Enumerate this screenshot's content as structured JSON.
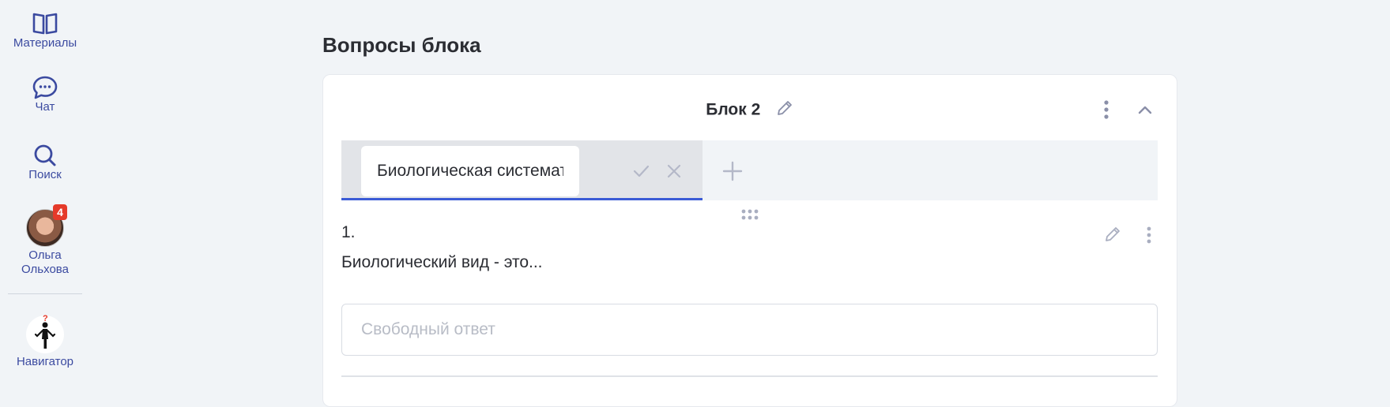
{
  "sidebar": {
    "items": [
      {
        "label": "Материалы",
        "icon": "book-icon"
      },
      {
        "label": "Чат",
        "icon": "chat-icon"
      },
      {
        "label": "Поиск",
        "icon": "search-icon"
      },
      {
        "label": "Ольга Ольхова",
        "icon": "avatar",
        "badge": "4"
      },
      {
        "label": "Навигатор",
        "icon": "navigator-icon"
      }
    ]
  },
  "main": {
    "title": "Вопросы блока",
    "block": {
      "title": "Блок 2",
      "tab": {
        "value": "Биологическая систематика"
      },
      "question": {
        "number": "1.",
        "text": "Биологический вид - это...",
        "answer_placeholder": "Свободный ответ"
      }
    }
  },
  "colors": {
    "accent": "#3b5bd6",
    "nav_text": "#3b4aa0",
    "badge": "#e53a2a",
    "background": "#f1f4f7"
  }
}
